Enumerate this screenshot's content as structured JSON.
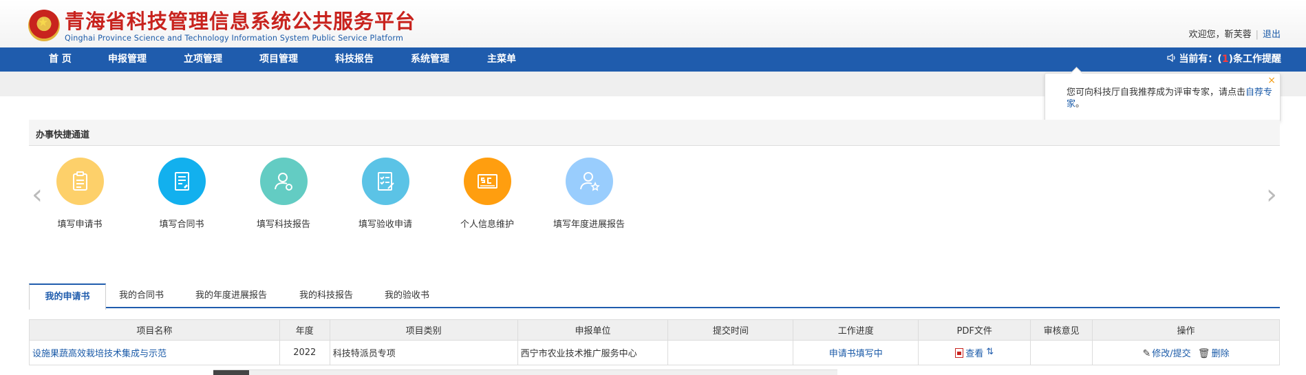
{
  "header": {
    "title": "青海省科技管理信息系统公共服务平台",
    "subtitle": "Qinghai Province Science and Technology Information System Public Service Platform",
    "welcome": "欢迎您，靳芙蓉",
    "logout": "退出"
  },
  "nav": {
    "items": [
      "首 页",
      "申报管理",
      "立项管理",
      "项目管理",
      "科技报告",
      "系统管理",
      "主菜单"
    ],
    "notice_prefix": "当前有：(",
    "notice_count": "1",
    "notice_suffix": ")条工作提醒"
  },
  "popup": {
    "text": "您可向科技厅自我推荐成为评审专家，请点击",
    "link": "自荐专家",
    "end": "。",
    "close": "×"
  },
  "quick_access": {
    "title": "办事快捷通道",
    "prev": "‹",
    "next": "›",
    "items": [
      {
        "label": "填写申请书",
        "icon": "clipboard-icon",
        "color": "#fdd06a"
      },
      {
        "label": "填写合同书",
        "icon": "contract-icon",
        "color": "#12b0ee"
      },
      {
        "label": "填写科技报告",
        "icon": "user-settings-icon",
        "color": "#63ccc3"
      },
      {
        "label": "填写验收申请",
        "icon": "checklist-icon",
        "color": "#5bc3e6"
      },
      {
        "label": "个人信息维护",
        "icon": "profile-card-icon",
        "color": "#ff9e0f"
      },
      {
        "label": "填写年度进展报告",
        "icon": "user-star-icon",
        "color": "#99cdfd"
      }
    ]
  },
  "tabs": [
    "我的申请书",
    "我的合同书",
    "我的年度进展报告",
    "我的科技报告",
    "我的验收书"
  ],
  "table": {
    "headers": [
      "项目名称",
      "年度",
      "项目类别",
      "申报单位",
      "提交时间",
      "工作进度",
      "PDF文件",
      "审核意见",
      "操作"
    ],
    "rows": [
      {
        "name": "设施果蔬高效栽培技术集成与示范",
        "year": "2022",
        "category": "科技特派员专项",
        "unit": "西宁市农业技术推广服务中心",
        "submit_time": "",
        "progress": "申请书填写中",
        "pdf": "查看",
        "review": "",
        "edit": "修改/提交",
        "delete": "删除"
      }
    ]
  },
  "colors": {
    "nav_bg": "#1f5cad",
    "title_red": "#c8231e",
    "link_blue": "#1a5aa8"
  }
}
